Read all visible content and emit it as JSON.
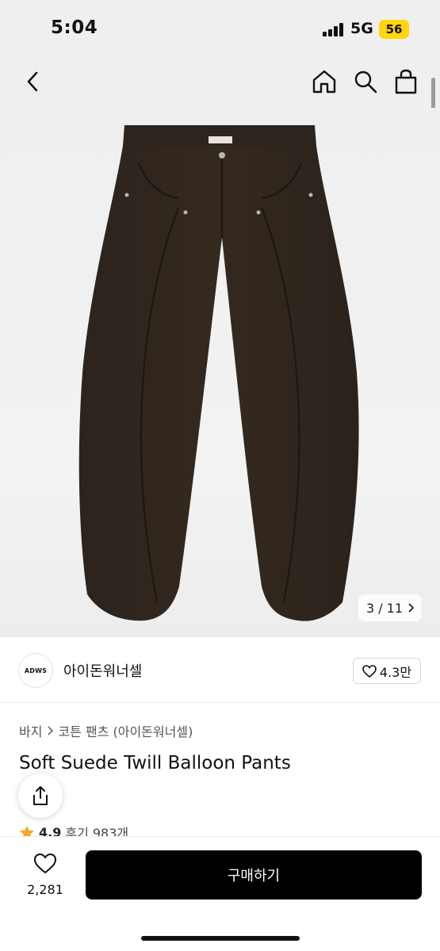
{
  "status_bar": {
    "time": "5:04",
    "network": "5G",
    "battery": "56"
  },
  "nav": {
    "back_icon": "chevron-left-icon",
    "home_icon": "home-icon",
    "search_icon": "search-icon",
    "bag_icon": "bag-icon"
  },
  "gallery": {
    "counter": "3 / 11"
  },
  "brand": {
    "logo_text": "ADWS",
    "name": "아이돈워너셀",
    "likes": "4.3만"
  },
  "breadcrumb": {
    "category": "바지",
    "subcategory": "코튼 팬츠 (아이돈워너셀)"
  },
  "product": {
    "title": "Soft Suede Twill Balloon Pants"
  },
  "rating": {
    "score": "4.9",
    "reviews": "후기 983개"
  },
  "bottom": {
    "wish_count": "2,281",
    "buy_label": "구매하기"
  },
  "colors": {
    "star": "#f5a623",
    "pants": "#2e2620",
    "button": "#000000"
  }
}
